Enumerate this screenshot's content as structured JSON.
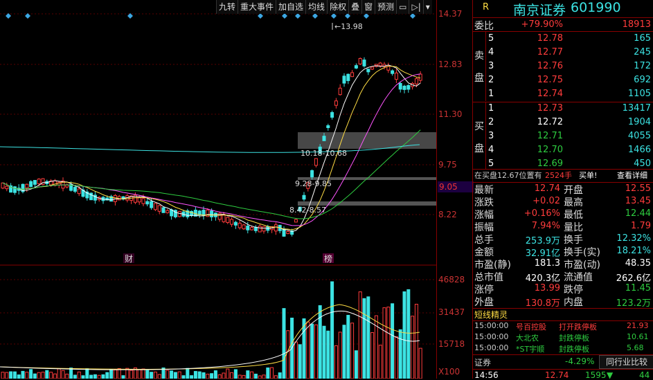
{
  "toolbar": {
    "items": [
      "九转",
      "重大事件",
      "加自选",
      "均线",
      "除权",
      "叠",
      "窗",
      "预测"
    ]
  },
  "chart": {
    "annotations": {
      "high_label": "13.98",
      "zone1": "10.18-10.68",
      "zone2": "9.28-9.85",
      "zone3": "8.42-8.57",
      "marker_cai": "财",
      "marker_bang": "榜"
    },
    "price_axis": [
      "14.37",
      "12.83",
      "11.30",
      "9.75",
      "8.22"
    ],
    "current_price": "9.05",
    "volume_axis": [
      "46828",
      "31437",
      "15718"
    ],
    "volume_unit": "X100"
  },
  "header": {
    "r_label": "R",
    "stock_name": "南京证券",
    "stock_code": "601990"
  },
  "weibi": {
    "label": "委比",
    "pct": "+79.90%",
    "diff": "18913"
  },
  "sell": {
    "label": "卖\n盘",
    "rows": [
      {
        "lv": "5",
        "price": "12.78",
        "vol": "165"
      },
      {
        "lv": "4",
        "price": "12.77",
        "vol": "245"
      },
      {
        "lv": "3",
        "price": "12.76",
        "vol": "172"
      },
      {
        "lv": "2",
        "price": "12.75",
        "vol": "692"
      },
      {
        "lv": "1",
        "price": "12.74",
        "vol": "1105"
      }
    ]
  },
  "buy": {
    "label": "买\n盘",
    "rows": [
      {
        "lv": "1",
        "price": "12.73",
        "vol": "13417"
      },
      {
        "lv": "2",
        "price": "12.72",
        "vol": "1904"
      },
      {
        "lv": "3",
        "price": "12.71",
        "vol": "4055"
      },
      {
        "lv": "4",
        "price": "12.70",
        "vol": "1466"
      },
      {
        "lv": "5",
        "price": "12.69",
        "vol": "450"
      }
    ]
  },
  "notice": {
    "text": "在买盘12.67位置有",
    "qty": "2524手",
    "action": "买单!",
    "link": "查看详细"
  },
  "stats": [
    {
      "l1": "最新",
      "v1": "12.74",
      "c1": "red",
      "l2": "开盘",
      "v2": "12.55",
      "c2": "red"
    },
    {
      "l1": "涨跌",
      "v1": "+0.02",
      "c1": "red",
      "l2": "最高",
      "v2": "13.45",
      "c2": "red"
    },
    {
      "l1": "涨幅",
      "v1": "+0.16%",
      "c1": "red",
      "l2": "最低",
      "v2": "12.44",
      "c2": "grn"
    },
    {
      "l1": "振幅",
      "v1": "7.94%",
      "c1": "red",
      "l2": "量比",
      "v2": "1.79",
      "c2": "red"
    },
    {
      "l1": "总手",
      "v1": "253.9万",
      "c1": "cyn",
      "l2": "换手",
      "v2": "12.32%",
      "c2": "cyn"
    },
    {
      "l1": "金额",
      "v1": "32.91亿",
      "c1": "cyn",
      "l2": "换手(实)",
      "v2": "18.21%",
      "c2": "cyn"
    },
    {
      "l1": "市盈(静)",
      "v1": "181.3",
      "c1": "wht",
      "l2": "市盈(动)",
      "v2": "48.35",
      "c2": "wht"
    },
    {
      "l1": "总市值",
      "v1": "420.3亿",
      "c1": "wht",
      "l2": "流通值",
      "v2": "262.6亿",
      "c2": "wht"
    },
    {
      "l1": "涨停",
      "v1": "13.99",
      "c1": "red",
      "l2": "跌停",
      "v2": "11.45",
      "c2": "grn"
    },
    {
      "l1": "外盘",
      "v1": "130.8万",
      "c1": "red",
      "l2": "内盘",
      "v2": "123.2万",
      "c2": "grn"
    }
  ],
  "genie": {
    "title": "短线精灵",
    "rows": [
      {
        "time": "15:00:00",
        "name": "号百控股",
        "event": "打开跌停板",
        "val": "21.93",
        "nc": "red",
        "ec": "red",
        "vc": "red"
      },
      {
        "time": "15:00:00",
        "name": "大北农",
        "event": "封跌停板",
        "val": "10.61",
        "nc": "grn",
        "ec": "grn",
        "vc": "grn"
      },
      {
        "time": "15:00:00",
        "name": "*ST宇顺",
        "event": "封跌停板",
        "val": "5.68",
        "nc": "grn",
        "ec": "grn",
        "vc": "grn"
      }
    ]
  },
  "footer": {
    "sector": "证券",
    "sector_pct": "-4.29%",
    "compare": "同行业比较",
    "time": "14:56",
    "price": "12.74",
    "vol": "1595",
    "arrow": "▼",
    "count": "44"
  }
}
